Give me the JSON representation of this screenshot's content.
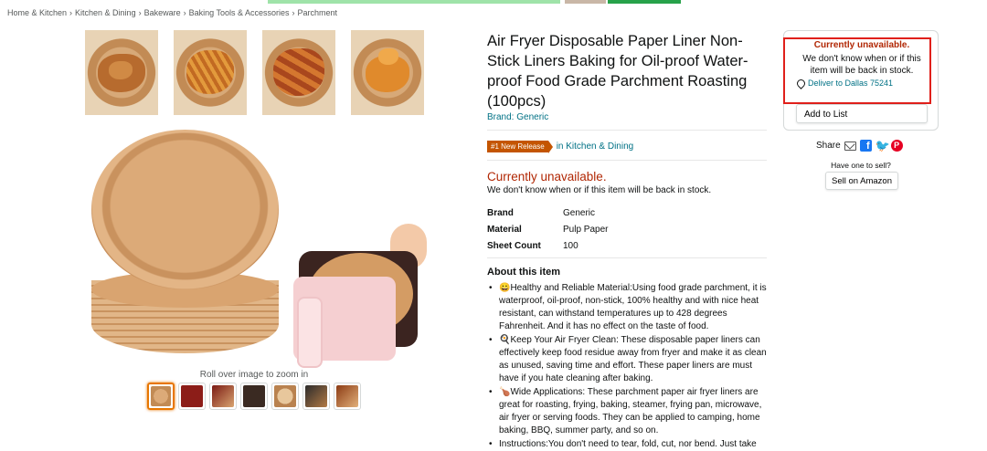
{
  "breadcrumb": [
    "Home & Kitchen",
    "Kitchen & Dining",
    "Bakeware",
    "Baking Tools & Accessories",
    "Parchment"
  ],
  "breadcrumb_sep": "›",
  "gallery": {
    "zoom_hint": "Roll over image to zoom in",
    "thumbnail_count": 7
  },
  "product": {
    "title": "Air Fryer Disposable Paper Liner Non-Stick Liners Baking for Oil-proof Water-proof Food Grade Parchment Roasting (100pcs)",
    "brand_link": "Brand: Generic",
    "badge": "#1 New Release",
    "badge_category": "in Kitchen & Dining",
    "availability": "Currently unavailable.",
    "availability_sub": "We don't know when or if this item will be back in stock.",
    "specs": [
      {
        "key": "Brand",
        "value": "Generic"
      },
      {
        "key": "Material",
        "value": "Pulp Paper"
      },
      {
        "key": "Sheet Count",
        "value": "100"
      }
    ],
    "about_title": "About this item",
    "about": [
      "😀Healthy and Reliable Material:Using food grade parchment, it is waterproof, oil-proof, non-stick, 100% healthy and with nice heat resistant, can withstand temperatures up to 428 degrees Fahrenheit. And it has no effect on the taste of food.",
      "🍳Keep Your Air Fryer Clean: These disposable paper liners can effectively keep food residue away from fryer and make it as clean as unused, saving time and effort. These paper liners are must have if you hate cleaning after baking.",
      "🍗Wide Applications: These parchment paper air fryer liners are great for roasting, frying, baking, steamer, frying pan, microwave, air fryer or serving foods. They can be applied to camping, home baking, BBQ, summer party, and so on.",
      " Instructions:You don't need to tear, fold, cut, nor bend. Just take"
    ]
  },
  "buybox": {
    "unavailable": "Currently unavailable.",
    "unavailable_sub": "We don't know when or if this item will be back in stock.",
    "deliver": "Deliver to Dallas 75241",
    "add_to_list": "Add to List",
    "share": "Share",
    "have_one": "Have one to sell?",
    "sell_button": "Sell on Amazon",
    "fb_glyph": "f",
    "tw_glyph": "🐦",
    "pin_glyph": "P"
  },
  "colors": {
    "link": "#007185",
    "price_red": "#b12704",
    "badge_orange": "#c45500",
    "highlight_box": "#e0201b"
  }
}
